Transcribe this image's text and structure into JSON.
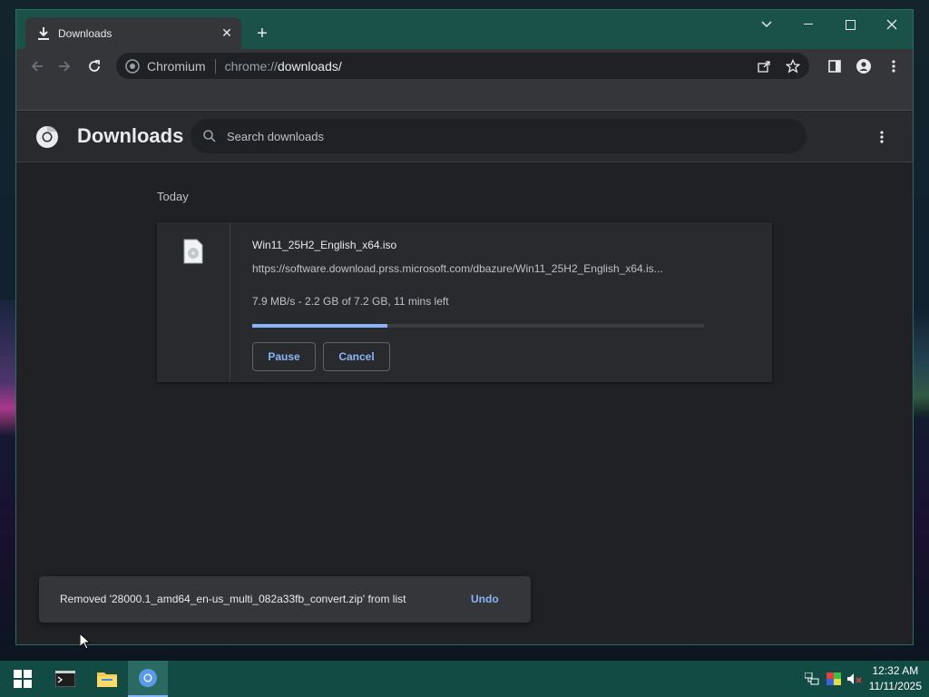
{
  "window": {
    "tab_title": "Downloads",
    "tab_close": "✕",
    "new_tab": "+"
  },
  "omnibox": {
    "site_label": "Chromium",
    "url_prefix": "chrome://",
    "url_path": "downloads/"
  },
  "page": {
    "title": "Downloads",
    "search_placeholder": "Search downloads",
    "day_label": "Today"
  },
  "download": {
    "file_name": "Win11_25H2_English_x64.iso",
    "url": "https://software.download.prss.microsoft.com/dbazure/Win11_25H2_English_x64.is...",
    "status": "7.9 MB/s - 2.2 GB of 7.2 GB, 11 mins left",
    "progress": 0.3,
    "pause_label": "Pause",
    "cancel_label": "Cancel"
  },
  "toast": {
    "message": "Removed '28000.1_amd64_en-us_multi_082a33fb_convert.zip' from list",
    "undo_label": "Undo"
  },
  "taskbar": {
    "time": "12:32 AM",
    "date": "11/11/2025"
  },
  "colors": {
    "accent": "#8ab4f8",
    "titlebar": "#1b5247",
    "taskbar": "#124a44"
  }
}
